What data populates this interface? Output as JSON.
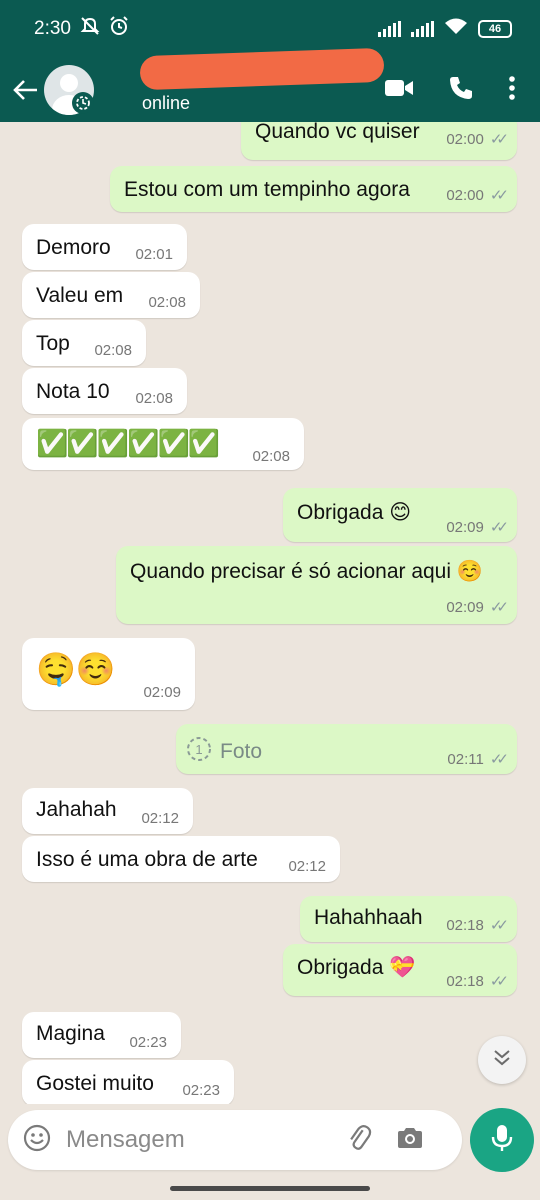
{
  "status_bar": {
    "time": "2:30",
    "battery": "46"
  },
  "header": {
    "status": "online"
  },
  "messages": [
    {
      "dir": "out",
      "text": "Quando vc quiser",
      "time": "02:00"
    },
    {
      "dir": "out",
      "text": "Estou com um tempinho agora",
      "time": "02:00"
    },
    {
      "dir": "in",
      "text": "Demoro",
      "time": "02:01"
    },
    {
      "dir": "in",
      "text": "Valeu em",
      "time": "02:08"
    },
    {
      "dir": "in",
      "text": "Top",
      "time": "02:08"
    },
    {
      "dir": "in",
      "text": "Nota 10",
      "time": "02:08"
    },
    {
      "dir": "in",
      "text": "✅✅✅✅✅✅",
      "time": "02:08"
    },
    {
      "dir": "out",
      "text": "Obrigada 😊",
      "time": "02:09"
    },
    {
      "dir": "out",
      "text": "Quando precisar é só acionar aqui ☺️",
      "time": "02:09"
    },
    {
      "dir": "in",
      "text": "🤤☺️",
      "time": "02:09"
    },
    {
      "dir": "out",
      "text": "Foto",
      "time": "02:11"
    },
    {
      "dir": "in",
      "text": "Jahahah",
      "time": "02:12"
    },
    {
      "dir": "in",
      "text": "Isso é uma obra de arte",
      "time": "02:12"
    },
    {
      "dir": "out",
      "text": "Hahahhaah",
      "time": "02:18"
    },
    {
      "dir": "out",
      "text": "Obrigada 💝",
      "time": "02:18"
    },
    {
      "dir": "in",
      "text": "Magina",
      "time": "02:23"
    },
    {
      "dir": "in",
      "text": "Gostei muito",
      "time": "02:23"
    }
  ],
  "input": {
    "placeholder": "Mensagem"
  },
  "icons": {
    "back": "arrow-left-icon",
    "video": "video-call-icon",
    "call": "phone-icon",
    "menu": "more-vert-icon",
    "emoji": "emoji-icon",
    "attach": "paperclip-icon",
    "camera": "camera-icon",
    "mic": "mic-icon",
    "view_once": "view-once-icon",
    "scroll_down": "double-chevron-down-icon"
  },
  "colors": {
    "header": "#0b5a51",
    "outgoing": "#dcf8c6",
    "incoming": "#ffffff",
    "mic": "#1aa584",
    "background": "#ece5dd"
  }
}
